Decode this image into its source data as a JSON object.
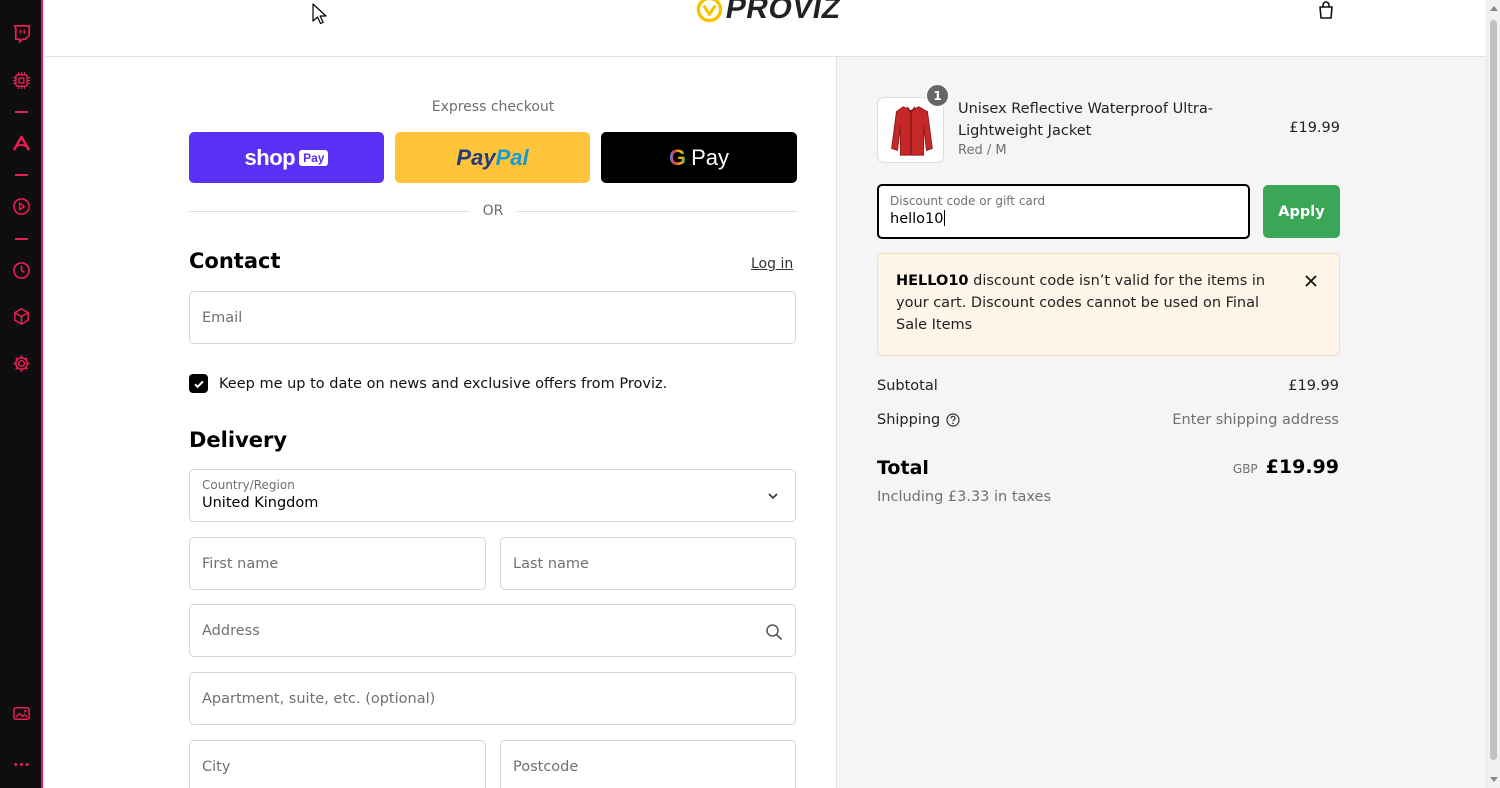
{
  "brand": {
    "logo_text": "PROVIZ"
  },
  "express": {
    "label": "Express checkout",
    "shop_pay": {
      "text": "shop",
      "badge": "Pay"
    },
    "paypal": {
      "pay": "Pay",
      "pal": "Pal"
    },
    "gpay": {
      "g": "G",
      "text": "Pay"
    },
    "divider": "OR"
  },
  "contact": {
    "title": "Contact",
    "login_link": "Log in",
    "email_placeholder": "Email",
    "newsletter_label": "Keep me up to date on news and exclusive offers from Proviz.",
    "newsletter_checked": true
  },
  "delivery": {
    "title": "Delivery",
    "country_label": "Country/Region",
    "country_value": "United Kingdom",
    "first_name_placeholder": "First name",
    "last_name_placeholder": "Last name",
    "address_placeholder": "Address",
    "apartment_placeholder": "Apartment, suite, etc. (optional)",
    "city_placeholder": "City",
    "postcode_placeholder": "Postcode"
  },
  "cart": {
    "item": {
      "quantity": "1",
      "name": "Unisex Reflective Waterproof Ultra-Lightweight Jacket",
      "variant": "Red / M",
      "price": "£19.99",
      "color": "#c62828"
    },
    "discount": {
      "label": "Discount code or gift card",
      "value": "hello10",
      "apply_label": "Apply"
    },
    "error": {
      "code": "HELLO10",
      "message": " discount code isn’t valid for the items in your cart. Discount codes cannot be used on Final Sale Items"
    },
    "subtotal_label": "Subtotal",
    "subtotal_value": "£19.99",
    "shipping_label": "Shipping",
    "shipping_value": "Enter shipping address",
    "total_label": "Total",
    "currency": "GBP",
    "total_value": "£19.99",
    "tax_note": "Including £3.33 in taxes"
  },
  "colors": {
    "accent_sidebar": "#e91e52",
    "shop_pay": "#5a31f4",
    "paypal": "#ffc439",
    "apply_green": "#3aa757",
    "alert_bg": "#fff4e8"
  }
}
